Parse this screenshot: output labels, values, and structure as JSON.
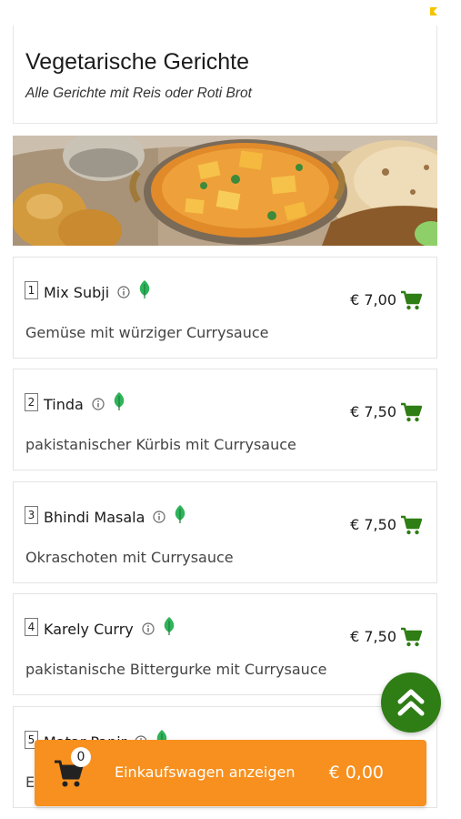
{
  "header": {
    "title": "Vegetarische Gerichte",
    "subtitle": "Alle Gerichte mit Reis oder Roti Brot"
  },
  "items": [
    {
      "number": "1",
      "name": "Mix Subji",
      "description": "Gemüse mit würziger Currysauce",
      "price": "€ 7,00"
    },
    {
      "number": "2",
      "name": "Tinda",
      "description": "pakistanischer Kürbis mit Currysauce",
      "price": "€ 7,50"
    },
    {
      "number": "3",
      "name": "Bhindi Masala",
      "description": "Okraschoten mit Currysauce",
      "price": "€ 7,50"
    },
    {
      "number": "4",
      "name": "Karely Curry",
      "description": "pakistanische Bittergurke mit Currysauce",
      "price": "€ 7,50"
    },
    {
      "number": "5",
      "name": "Matar Panir",
      "description": "E",
      "price": ""
    }
  ],
  "cart": {
    "count": "0",
    "label": "Einkaufswagen anzeigen",
    "total": "€ 0,00"
  },
  "colors": {
    "accent_green": "#2f7d15",
    "leaf_green": "#2fb35a",
    "cart_orange": "#f7901e"
  },
  "icons": [
    "info-icon",
    "vegetarian-leaf-icon",
    "add-to-cart-icon",
    "double-chevron-up-icon",
    "shopping-cart-icon"
  ]
}
